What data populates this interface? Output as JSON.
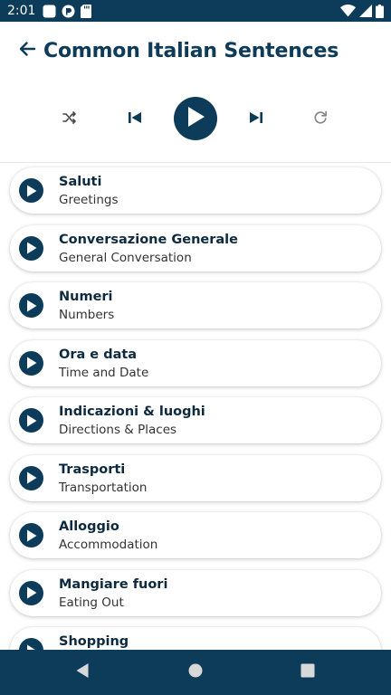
{
  "status_bar": {
    "time": "2:01",
    "left_icons": [
      "square-notification-icon",
      "pocket-app-icon",
      "sd-card-icon"
    ],
    "right_icons": [
      "wifi-icon",
      "cell-signal-icon",
      "battery-icon"
    ]
  },
  "header": {
    "title": "Common Italian Sentences",
    "back_icon": "arrow-back-icon"
  },
  "player": {
    "controls": [
      "shuffle-icon",
      "skip-previous-icon",
      "play-icon",
      "skip-next-icon",
      "repeat-icon"
    ]
  },
  "categories": [
    {
      "title": "Saluti",
      "subtitle": "Greetings"
    },
    {
      "title": "Conversazione Generale",
      "subtitle": "General Conversation"
    },
    {
      "title": "Numeri",
      "subtitle": "Numbers"
    },
    {
      "title": "Ora e data",
      "subtitle": "Time and Date"
    },
    {
      "title": "Indicazioni & luoghi",
      "subtitle": "Directions & Places"
    },
    {
      "title": "Trasporti",
      "subtitle": "Transportation"
    },
    {
      "title": "Alloggio",
      "subtitle": "Accommodation"
    },
    {
      "title": "Mangiare fuori",
      "subtitle": "Eating Out"
    },
    {
      "title": "Shopping",
      "subtitle": ""
    }
  ],
  "nav_bar": {
    "buttons": [
      "back-triangle-icon",
      "home-circle-icon",
      "recents-square-icon"
    ]
  },
  "colors": {
    "primary": "#0d3b5a",
    "title_text": "#0d2a40",
    "background": "#ffffff"
  }
}
